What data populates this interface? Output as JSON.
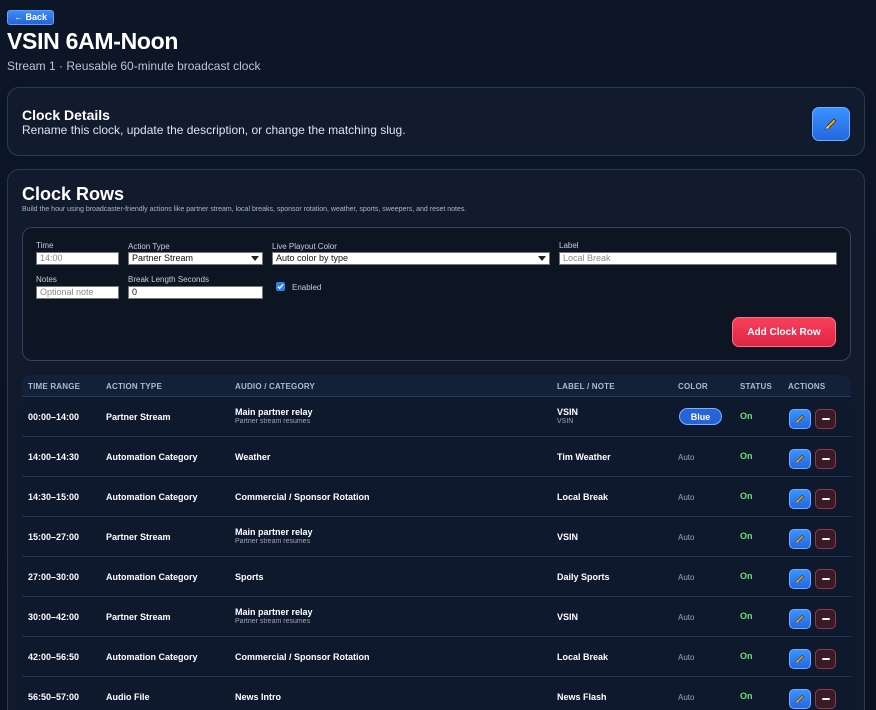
{
  "header": {
    "back_label": "← Back",
    "title": "VSIN 6AM-Noon",
    "subtitle": "Stream 1 · Reusable 60-minute broadcast clock"
  },
  "details": {
    "title": "Clock Details",
    "description": "Rename this clock, update the description, or change the matching slug.",
    "edit_icon": "pencil-icon"
  },
  "clock_rows": {
    "title": "Clock Rows",
    "description": "Build the hour using broadcaster-friendly actions like partner stream, local breaks, sponsor rotation, weather, sports, sweepers, and reset notes."
  },
  "form": {
    "time_label": "Time",
    "time_placeholder": "14:00",
    "action_type_label": "Action Type",
    "action_type_value": "Partner Stream",
    "color_label": "Live Playout Color",
    "color_value": "Auto color by type",
    "label_label": "Label",
    "label_placeholder": "Local Break",
    "notes_label": "Notes",
    "notes_placeholder": "Optional note",
    "break_label": "Break Length Seconds",
    "break_value": "0",
    "enabled_label": "Enabled",
    "enabled_checked": true,
    "add_button": "Add Clock Row"
  },
  "table": {
    "headers": {
      "time_range": "TIME RANGE",
      "action_type": "ACTION TYPE",
      "audio": "AUDIO / CATEGORY",
      "label": "LABEL / NOTE",
      "color": "COLOR",
      "status": "STATUS",
      "actions": "ACTIONS"
    },
    "rows": [
      {
        "time": "00:00–14:00",
        "action": "Partner Stream",
        "audio": "Main partner relay",
        "audio_sub": "Partner stream resumes",
        "label": "VSIN",
        "label_sub": "VSIN",
        "color": "Blue",
        "status": "On"
      },
      {
        "time": "14:00–14:30",
        "action": "Automation Category",
        "audio": "Weather",
        "audio_sub": "",
        "label": "Tim Weather",
        "label_sub": "",
        "color": "Auto",
        "status": "On"
      },
      {
        "time": "14:30–15:00",
        "action": "Automation Category",
        "audio": "Commercial / Sponsor Rotation",
        "audio_sub": "",
        "label": "Local Break",
        "label_sub": "",
        "color": "Auto",
        "status": "On"
      },
      {
        "time": "15:00–27:00",
        "action": "Partner Stream",
        "audio": "Main partner relay",
        "audio_sub": "Partner stream resumes",
        "label": "VSIN",
        "label_sub": "",
        "color": "Auto",
        "status": "On"
      },
      {
        "time": "27:00–30:00",
        "action": "Automation Category",
        "audio": "Sports",
        "audio_sub": "",
        "label": "Daily Sports",
        "label_sub": "",
        "color": "Auto",
        "status": "On"
      },
      {
        "time": "30:00–42:00",
        "action": "Partner Stream",
        "audio": "Main partner relay",
        "audio_sub": "Partner stream resumes",
        "label": "VSIN",
        "label_sub": "",
        "color": "Auto",
        "status": "On"
      },
      {
        "time": "42:00–56:50",
        "action": "Automation Category",
        "audio": "Commercial / Sponsor Rotation",
        "audio_sub": "",
        "label": "Local Break",
        "label_sub": "",
        "color": "Auto",
        "status": "On"
      },
      {
        "time": "56:50–57:00",
        "action": "Audio File",
        "audio": "News Intro",
        "audio_sub": "",
        "label": "News Flash",
        "label_sub": "",
        "color": "Auto",
        "status": "On"
      }
    ]
  }
}
